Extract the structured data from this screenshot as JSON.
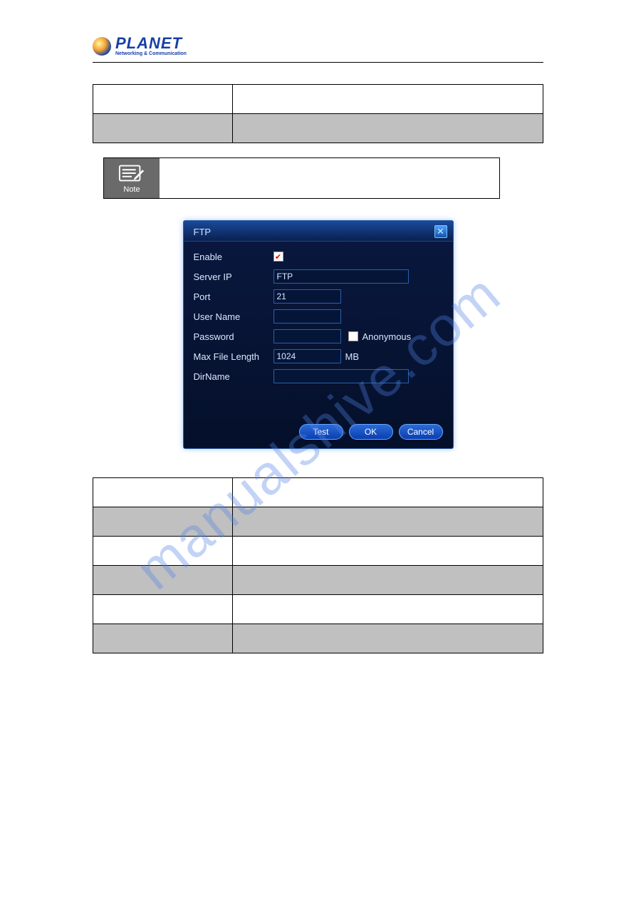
{
  "logo": {
    "brand": "PLANET",
    "tagline": "Networking & Communication"
  },
  "table1": {
    "rows": [
      {
        "col1": "",
        "col2": ""
      },
      {
        "col1": "",
        "col2": ""
      }
    ]
  },
  "note": {
    "label": "Note",
    "content": ""
  },
  "dialog": {
    "title": "FTP",
    "fields": {
      "enable_label": "Enable",
      "enable_checked": true,
      "server_ip_label": "Server IP",
      "server_ip_value": "FTP",
      "port_label": "Port",
      "port_value": "21",
      "user_name_label": "User Name",
      "user_name_value": "",
      "password_label": "Password",
      "password_value": "",
      "anonymous_label": "Anonymous",
      "anonymous_checked": false,
      "max_file_length_label": "Max File Length",
      "max_file_length_value": "1024",
      "max_file_length_unit": "MB",
      "dir_name_label": "DirName",
      "dir_name_value": ""
    },
    "buttons": {
      "test": "Test",
      "ok": "OK",
      "cancel": "Cancel"
    }
  },
  "table2": {
    "rows": [
      {
        "col1": "",
        "col2": ""
      },
      {
        "col1": "",
        "col2": ""
      },
      {
        "col1": "",
        "col2": ""
      },
      {
        "col1": "",
        "col2": ""
      },
      {
        "col1": "",
        "col2": ""
      },
      {
        "col1": "",
        "col2": ""
      }
    ]
  },
  "watermark": "manualshive.com",
  "page_number": ""
}
